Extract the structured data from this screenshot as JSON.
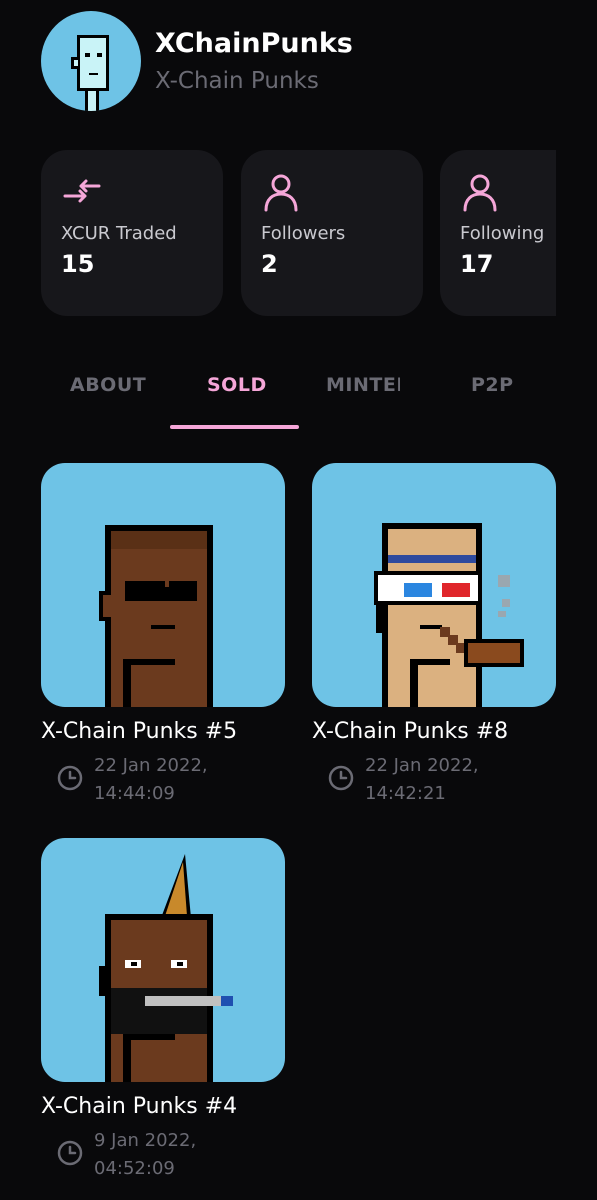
{
  "profile": {
    "name": "XChainPunks",
    "handle": "X-Chain Punks",
    "avatar_icon": "punk-avatar-icon"
  },
  "stats": [
    {
      "icon": "swap-arrows-icon",
      "label": "XCUR Traded",
      "value": "15"
    },
    {
      "icon": "user-icon",
      "label": "Followers",
      "value": "2"
    },
    {
      "icon": "user-icon",
      "label": "Following",
      "value": "17"
    }
  ],
  "tabs": [
    {
      "label": "ABOUT",
      "active": false
    },
    {
      "label": "SOLD",
      "active": true
    },
    {
      "label": "MINTED",
      "active": false
    },
    {
      "label": "P2P",
      "active": false
    }
  ],
  "items": [
    {
      "title": "X-Chain Punks #5",
      "date": "22 Jan 2022,",
      "time": "14:44:09"
    },
    {
      "title": "X-Chain Punks #8",
      "date": "22 Jan 2022,",
      "time": "14:42:21"
    },
    {
      "title": "X-Chain Punks #4",
      "date": "9 Jan 2022,",
      "time": "04:52:09"
    }
  ],
  "colors": {
    "background": "#09090b",
    "card": "#17171b",
    "accent": "#f5a6d8",
    "muted": "#6b6b74",
    "nft_background": "#6ec3e6"
  }
}
